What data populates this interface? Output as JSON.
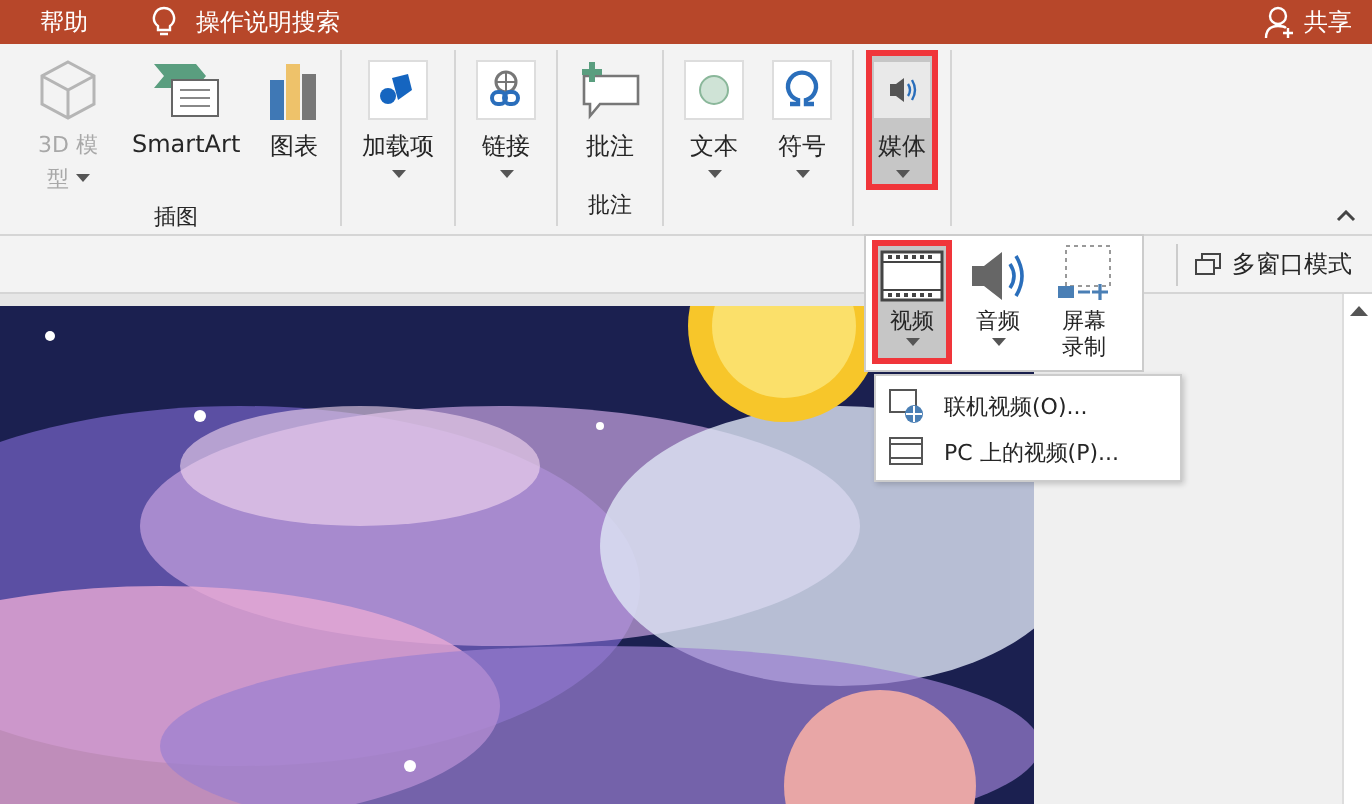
{
  "title_bar": {
    "items": [
      {
        "kind": "tab",
        "label": "帮助"
      },
      {
        "kind": "search",
        "label": "操作说明搜索"
      }
    ],
    "share": "共享"
  },
  "ribbon": {
    "groups": [
      {
        "label": "插图",
        "commands": [
          {
            "kind": "cube",
            "label": "3D 模型",
            "caret": true,
            "disabled": true,
            "selected": false,
            "highlighted": false
          },
          {
            "kind": "smartart",
            "label": "SmartArt",
            "caret": false,
            "disabled": false,
            "selected": false,
            "highlighted": false
          },
          {
            "kind": "chart",
            "label": "图表",
            "caret": false,
            "disabled": false,
            "selected": false,
            "highlighted": false
          }
        ]
      },
      {
        "commands": [
          {
            "kind": "addin",
            "label": "加载项",
            "caret": true,
            "disabled": false,
            "selected": false,
            "highlighted": false
          }
        ]
      },
      {
        "commands": [
          {
            "kind": "link",
            "label": "链接",
            "caret": true,
            "disabled": false,
            "selected": false,
            "highlighted": false
          }
        ]
      },
      {
        "label": "批注",
        "commands": [
          {
            "kind": "comment",
            "label": "批注",
            "caret": false,
            "disabled": false,
            "selected": false,
            "highlighted": false
          }
        ]
      },
      {
        "commands": [
          {
            "kind": "text",
            "label": "文本",
            "caret": true,
            "disabled": false,
            "selected": false,
            "highlighted": false
          },
          {
            "kind": "symbol",
            "label": "符号",
            "caret": true,
            "disabled": false,
            "selected": false,
            "highlighted": false
          }
        ]
      },
      {
        "commands": [
          {
            "kind": "media",
            "label": "媒体",
            "caret": true,
            "disabled": false,
            "selected": true,
            "highlighted": true
          }
        ]
      }
    ]
  },
  "view_button": "多窗口模式",
  "media_menu": {
    "commands": [
      {
        "kind": "video",
        "label": "视频",
        "caret": true,
        "selected": true,
        "highlighted": true
      },
      {
        "kind": "audio",
        "label": "音频",
        "caret": true,
        "selected": false,
        "highlighted": false
      },
      {
        "kind": "record",
        "label": "屏幕录制",
        "caret": false,
        "selected": false,
        "highlighted": false
      }
    ],
    "video_items": [
      {
        "kind": "online",
        "label": "联机视频(O)..."
      },
      {
        "kind": "file",
        "label": "PC 上的视频(P)..."
      }
    ]
  }
}
